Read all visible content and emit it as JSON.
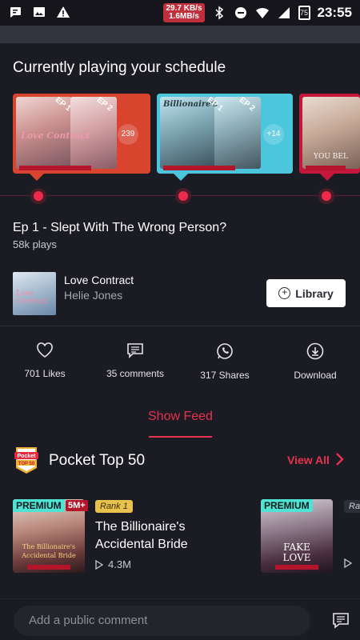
{
  "status_bar": {
    "net_speed_up": "29.7 KB/s",
    "net_speed_down": "1.6MB/s",
    "battery": "75",
    "time": "23:55",
    "icons": [
      "chat-bubble-icon",
      "image-icon",
      "warning-icon",
      "bluetooth-icon",
      "do-not-disturb-icon",
      "wifi-icon",
      "cellular-icon",
      "battery-icon"
    ]
  },
  "schedule": {
    "title": "Currently playing your schedule",
    "cards": [
      {
        "left_cover_label": "Love Contract",
        "ep_left": "EP 1",
        "ep_right": "EP 2",
        "count": "239",
        "color": "#d9442f"
      },
      {
        "left_cover_label": "Billionaire's",
        "ep_left": "EP 1",
        "ep_right": "EP 2",
        "count": "+14",
        "color": "#4cc6dc"
      },
      {
        "left_cover_label": "YOU BEL",
        "color": "#c4173a"
      }
    ]
  },
  "episode": {
    "title": "Ep 1 - Slept With The Wrong Person?",
    "plays": "58k plays"
  },
  "book": {
    "title": "Love Contract",
    "author": "Helie Jones",
    "library_label": "Library"
  },
  "actions": {
    "likes": "701 Likes",
    "comments": "35 comments",
    "shares": "317 Shares",
    "download": "Download"
  },
  "feed": {
    "show_feed_label": "Show Feed"
  },
  "pocket_top": {
    "logo_text": "Pocket TOP 50",
    "title": "Pocket Top 50",
    "view_all": "View All",
    "items": [
      {
        "premium": "PREMIUM",
        "badge": "5M+",
        "rank": "Rank 1",
        "title_line1": "The Billionaire's",
        "title_line2": "Accidental Bride",
        "plays": "4.3M",
        "cover_text": "The Billionaire's Accidental Bride"
      },
      {
        "premium": "PREMIUM",
        "rank": "Ra",
        "cover_text": "FAKE LOVE"
      }
    ]
  },
  "comment": {
    "placeholder": "Add a public comment"
  },
  "colors": {
    "accent": "#e8324f",
    "background": "#1b1b23",
    "premium": "#4fe3d3",
    "rank": "#e8c24d"
  }
}
